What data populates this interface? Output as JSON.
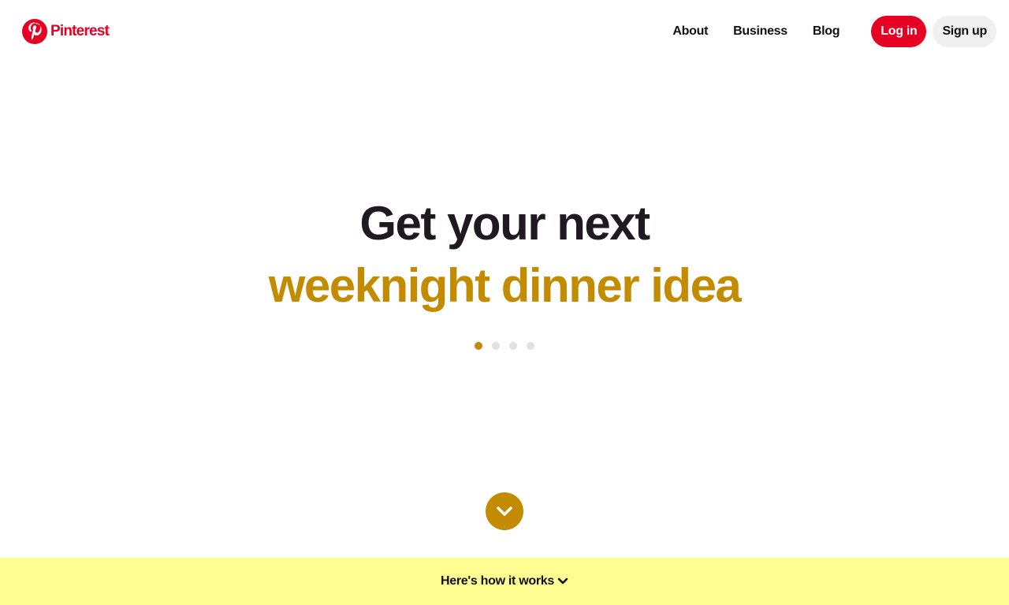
{
  "header": {
    "brand": "Pinterest",
    "brand_color": "#e60023",
    "logo_icon": "pinterest-logo-icon",
    "nav": [
      {
        "label": "About"
      },
      {
        "label": "Business"
      },
      {
        "label": "Blog"
      }
    ],
    "login_label": "Log in",
    "signup_label": "Sign up"
  },
  "hero": {
    "line1": "Get your next",
    "line2": "weeknight dinner idea",
    "accent_color": "#c28b00",
    "carousel": {
      "total": 4,
      "active_index": 0
    }
  },
  "scroll_button": {
    "icon": "chevron-down-icon"
  },
  "footer": {
    "label": "Here's how it works",
    "icon": "chevron-down-icon",
    "background": "#fffd92"
  }
}
